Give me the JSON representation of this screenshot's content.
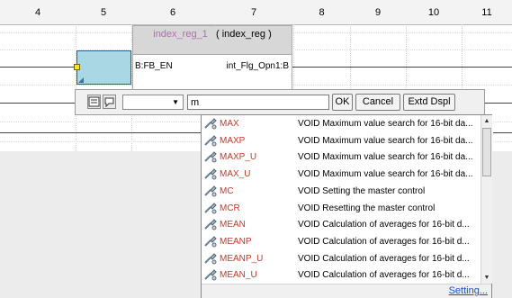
{
  "columns": [
    "4",
    "5",
    "6",
    "7",
    "8",
    "9",
    "10",
    "11"
  ],
  "function_block": {
    "instance": "index_reg_1",
    "type": "( index_reg )",
    "input_label": "B:FB_EN",
    "output_label": "int_Flg_Opn1:B"
  },
  "toolbar": {
    "input_value": "m",
    "ok_label": "OK",
    "cancel_label": "Cancel",
    "extd_label": "Extd Dspl"
  },
  "suggestions": [
    {
      "name": "MAX",
      "desc": "VOID Maximum value search for 16-bit da..."
    },
    {
      "name": "MAXP",
      "desc": "VOID Maximum value search for 16-bit da..."
    },
    {
      "name": "MAXP_U",
      "desc": "VOID Maximum value search for 16-bit da..."
    },
    {
      "name": "MAX_U",
      "desc": "VOID Maximum value search for 16-bit da..."
    },
    {
      "name": "MC",
      "desc": "VOID Setting the master control"
    },
    {
      "name": "MCR",
      "desc": "VOID Resetting the master control"
    },
    {
      "name": "MEAN",
      "desc": "VOID Calculation of averages for 16-bit d..."
    },
    {
      "name": "MEANP",
      "desc": "VOID Calculation of averages for 16-bit d..."
    },
    {
      "name": "MEANP_U",
      "desc": "VOID Calculation of averages for 16-bit d..."
    },
    {
      "name": "MEAN_U",
      "desc": "VOID Calculation of averages for 16-bit d..."
    }
  ],
  "footer": {
    "setting_label": "Setting..."
  }
}
